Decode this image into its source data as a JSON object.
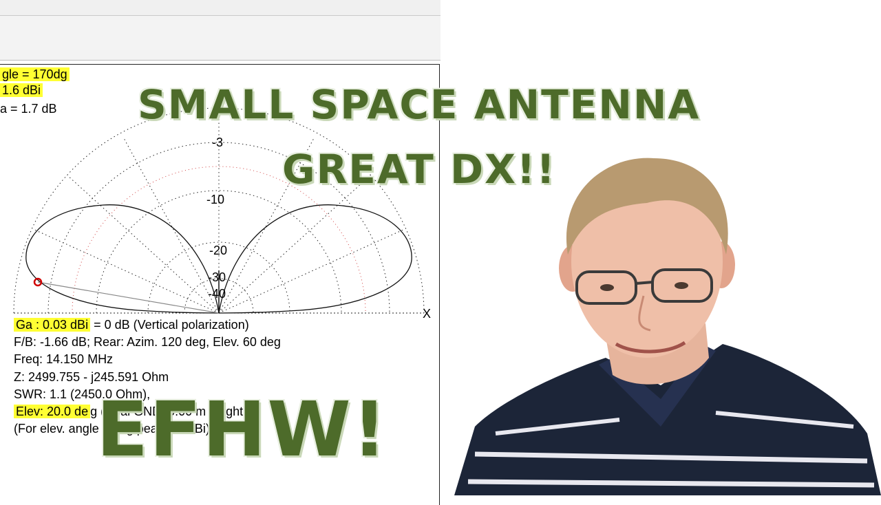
{
  "header_lines": [
    {
      "text": "gle = 170dg",
      "highlight": true
    },
    {
      "text": "1.6 dBi",
      "highlight": true
    },
    {
      "text": "a = 1.7 dB",
      "highlight": false
    }
  ],
  "polar": {
    "ring_labels": [
      "-3",
      "-10",
      "-20",
      "-30",
      "-40"
    ],
    "axis_label": "X"
  },
  "info": {
    "ga_highlight": "Ga : 0.03 dBi",
    "ga_rest": " = 0 dB  (Vertical polarization)",
    "fb": "F/B: -1.66 dB; Rear: Azim. 120 deg,  Elev. 60 deg",
    "freq": "Freq: 14.150 MHz",
    "z": "Z: 2499.755 - j245.591 Ohm",
    "swr": "SWR: 1.1 (2450.0 Ohm),",
    "elev_highlight": "Elev: 20.0 de",
    "elev_rest": "g (Real GND: 0.00 m height)",
    "note": "(For elev. angle 0 deg peak 1.6 dBi)"
  },
  "overlay": {
    "line1": "SMALL SPACE ANTENNA",
    "line2": "GREAT DX!!",
    "line3": "EFHW!"
  },
  "colors": {
    "highlight": "#ffff33",
    "title_green": "#4d6b2a",
    "marker_red": "#d00000",
    "dotted_red": "#d04040"
  }
}
